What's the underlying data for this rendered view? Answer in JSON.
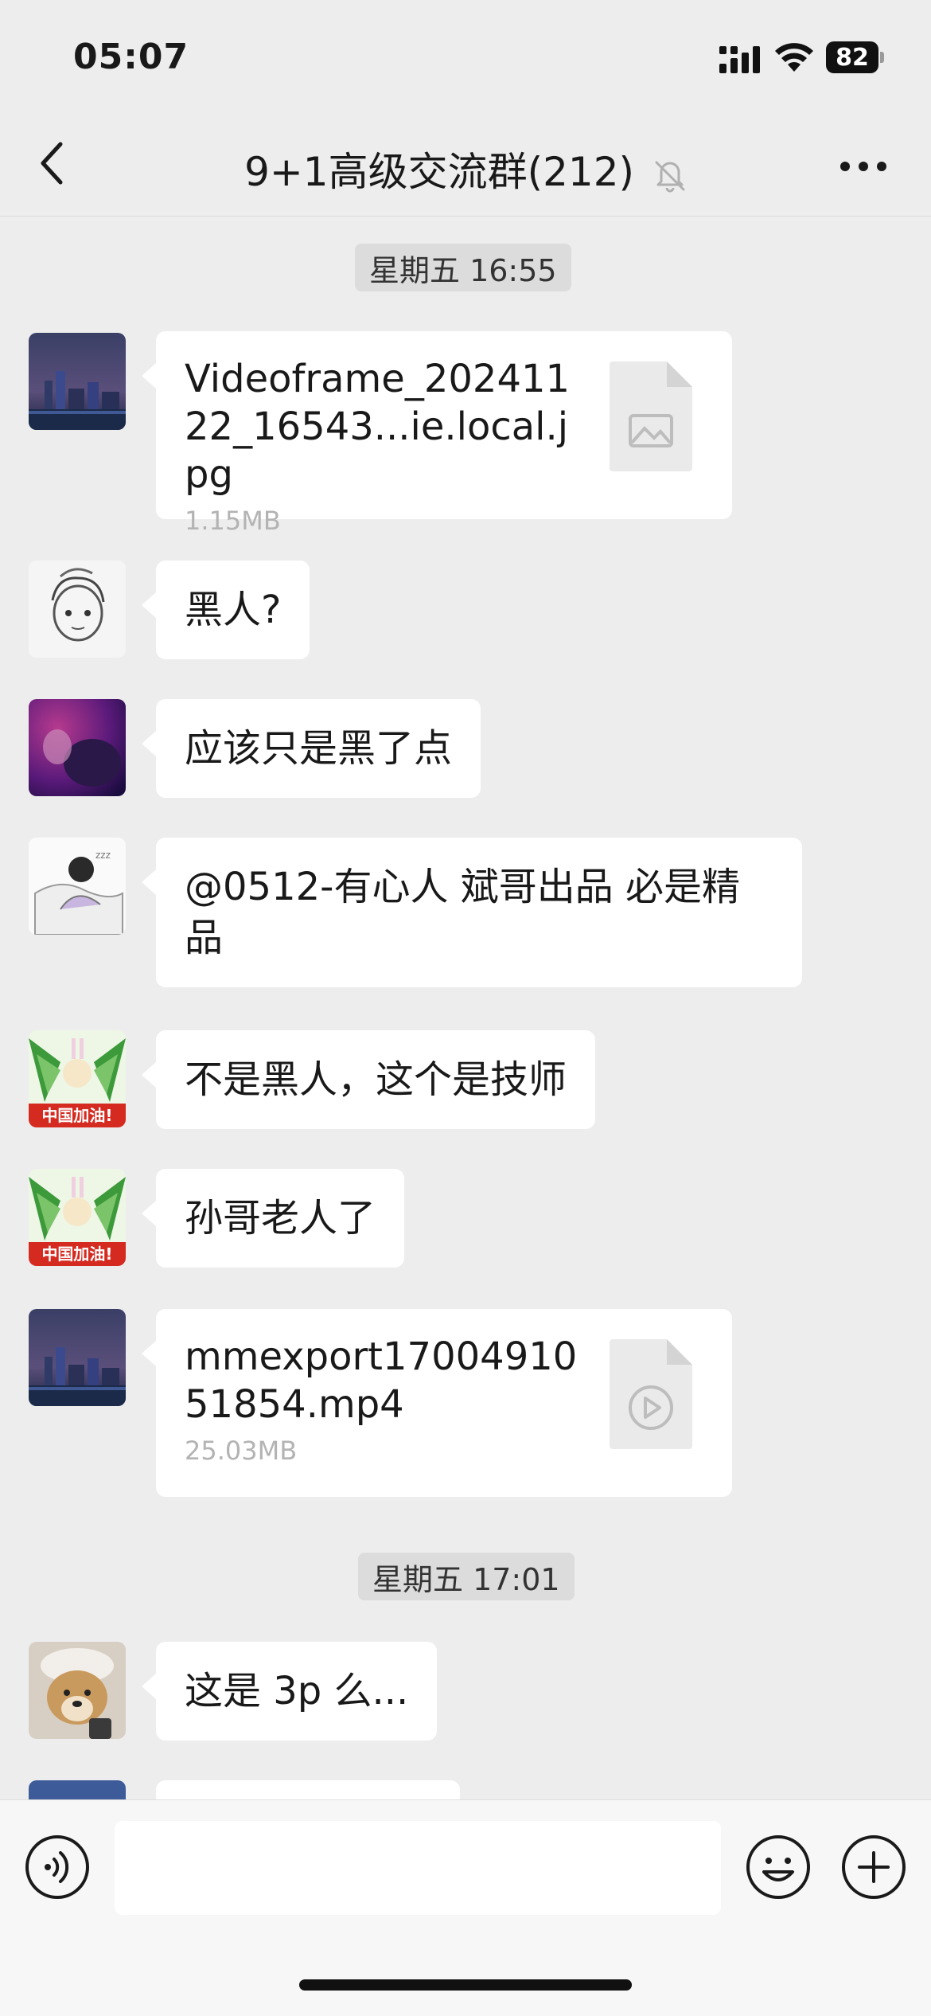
{
  "status_bar": {
    "time": "05:07",
    "battery": "82"
  },
  "nav": {
    "title": "9+1高级交流群(212)",
    "back_icon": "chevron-left-icon",
    "more_icon": "more-dots-icon",
    "mute_icon": "bell-muted-icon"
  },
  "timestamps": [
    "星期五 16:55",
    "星期五 17:01"
  ],
  "messages": [
    {
      "type": "file",
      "name": "Videoframe_20241122_16543...ie.local.jpg",
      "size": "1.15MB",
      "icon": "image-file-icon"
    },
    {
      "type": "text",
      "text": "黑人?"
    },
    {
      "type": "text",
      "text": "应该只是黑了点"
    },
    {
      "type": "text",
      "text": "@0512-有心人 斌哥出品  必是精品"
    },
    {
      "type": "text",
      "text": "不是黑人，这个是技师"
    },
    {
      "type": "text",
      "text": "孙哥老人了"
    },
    {
      "type": "file",
      "name": "mmexport1700491051854.mp4",
      "size": "25.03MB",
      "icon": "video-file-icon"
    },
    {
      "type": "text",
      "text": "这是 3p 么..."
    }
  ],
  "input_bar": {
    "voice_icon": "voice-icon",
    "emoji_icon": "emoji-icon",
    "plus_icon": "plus-icon"
  }
}
